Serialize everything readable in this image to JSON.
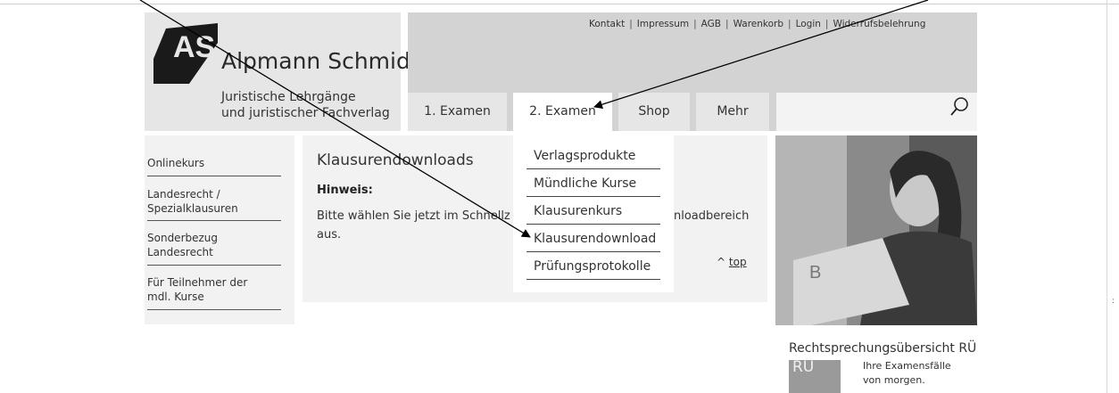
{
  "brand": {
    "logo_text": "AS",
    "name": "Alpmann Schmidt",
    "tagline_line1": "Juristische Lehrgänge",
    "tagline_line2": "und juristischer Fachverlag"
  },
  "toplinks": [
    "Kontakt",
    "Impressum",
    "AGB",
    "Warenkorb",
    "Login",
    "Widerrufsbelehrung"
  ],
  "tabs": [
    {
      "label": "1. Examen",
      "active": false
    },
    {
      "label": "2. Examen",
      "active": true
    },
    {
      "label": "Shop",
      "active": false
    },
    {
      "label": "Mehr",
      "active": false
    }
  ],
  "search": {
    "placeholder": "",
    "icon": "search-icon"
  },
  "leftnav": [
    {
      "line1": "Onlinekurs",
      "line2": ""
    },
    {
      "line1": "Landesrecht /",
      "line2": "Spezialklausuren"
    },
    {
      "line1": "Sonderbezug",
      "line2": "Landesrecht"
    },
    {
      "line1": "Für Teilnehmer der",
      "line2": "mdl. Kurse"
    }
  ],
  "content": {
    "title": "Klausurendownloads",
    "hint": "Hinweis:",
    "body_line1": "Bitte wählen Sie jetzt im Schnellz",
    "body_tail": "nloadbereich",
    "body_line2": "aus.",
    "top_caret": "^",
    "top_link": "top"
  },
  "dropdown": [
    "Verlagsprodukte",
    "Mündliche Kurse",
    "Klausurenkurs",
    "Klausurendownload",
    "Prüfungsprotokolle"
  ],
  "sidebar_promo": {
    "title": "Rechtsprechungsübersicht RÜ",
    "thumb_label": "RÜ",
    "text_line1": "Ihre Examensfälle",
    "text_line2": "von morgen."
  },
  "colors": {
    "header_bar": "#d3d3d3",
    "panel": "#f2f2f2",
    "logo_box": "#e6e6e6",
    "arrow": "#000000"
  }
}
